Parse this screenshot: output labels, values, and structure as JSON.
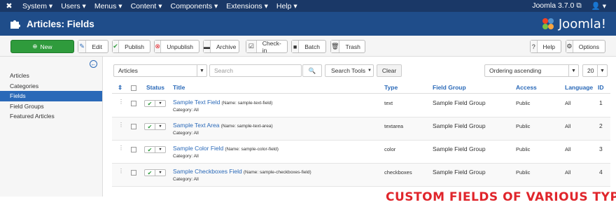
{
  "topnav": {
    "items": [
      "System",
      "Users",
      "Menus",
      "Content",
      "Components",
      "Extensions",
      "Help"
    ],
    "version": "Joomla 3.7.0",
    "user_icon": "user-icon"
  },
  "header": {
    "title": "Articles: Fields",
    "logo_text": "Joomla!"
  },
  "toolbar": {
    "new": "New",
    "edit": "Edit",
    "publish": "Publish",
    "unpublish": "Unpublish",
    "archive": "Archive",
    "checkin": "Check-in",
    "batch": "Batch",
    "trash": "Trash",
    "help": "Help",
    "options": "Options"
  },
  "sidebar": {
    "items": [
      {
        "label": "Articles",
        "active": false
      },
      {
        "label": "Categories",
        "active": false
      },
      {
        "label": "Fields",
        "active": true
      },
      {
        "label": "Field Groups",
        "active": false
      },
      {
        "label": "Featured Articles",
        "active": false
      }
    ]
  },
  "filters": {
    "context": "Articles",
    "search_placeholder": "Search",
    "search_tools": "Search Tools",
    "clear": "Clear",
    "ordering": "Ordering ascending",
    "limit": "20"
  },
  "table": {
    "headers": {
      "status": "Status",
      "title": "Title",
      "type": "Type",
      "group": "Field Group",
      "access": "Access",
      "language": "Language",
      "id": "ID"
    },
    "rows": [
      {
        "title": "Sample Text Field",
        "name": "(Name: sample-text-field)",
        "category": "Category: All",
        "type": "text",
        "group": "Sample Field Group",
        "access": "Public",
        "language": "All",
        "id": "1"
      },
      {
        "title": "Sample Text Area",
        "name": "(Name: sample-text-area)",
        "category": "Category: All",
        "type": "textarea",
        "group": "Sample Field Group",
        "access": "Public",
        "language": "All",
        "id": "2"
      },
      {
        "title": "Sample Color Field",
        "name": "(Name: sample-color-field)",
        "category": "Category: All",
        "type": "color",
        "group": "Sample Field Group",
        "access": "Public",
        "language": "All",
        "id": "3"
      },
      {
        "title": "Sample Checkboxes Field",
        "name": "(Name: sample-checkboxes-field)",
        "category": "Category: All",
        "type": "checkboxes",
        "group": "Sample Field Group",
        "access": "Public",
        "language": "All",
        "id": "4"
      }
    ]
  },
  "caption": "CUSTOM FIELDS OF VARIOUS TYPES",
  "colors": {
    "nav": "#1a3867",
    "header": "#1f4d8a",
    "accent": "#2a69b8",
    "new_button": "#2f9b3c",
    "caption": "#e0252b"
  }
}
